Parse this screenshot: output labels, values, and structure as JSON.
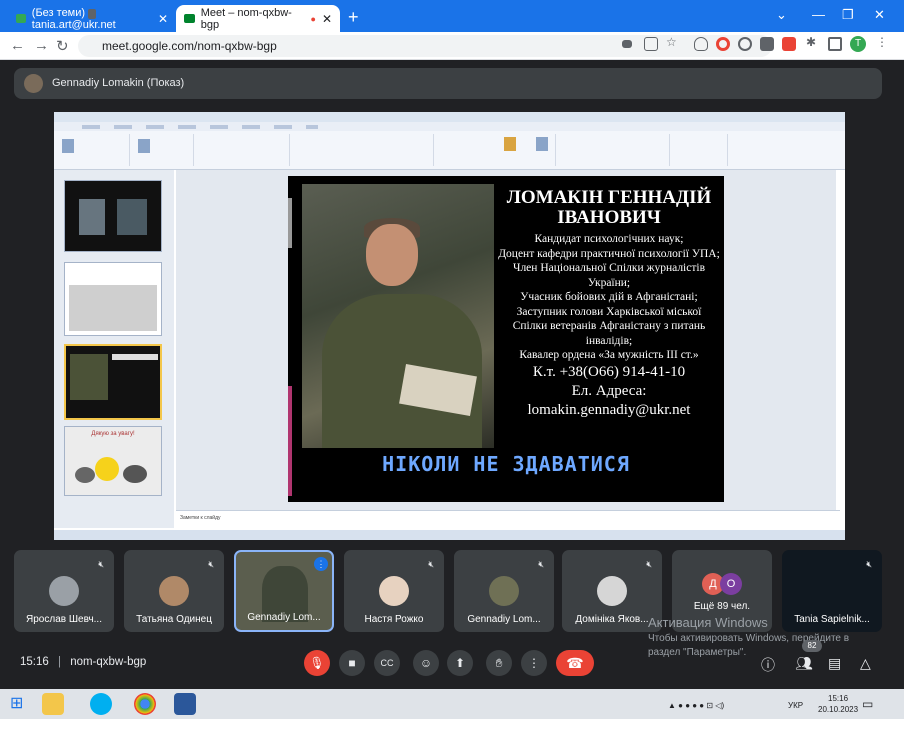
{
  "browser": {
    "tabs": [
      {
        "label": "(Без теми) • tania.art@ukr.net",
        "active": false
      },
      {
        "label": "Meet – nom-qxbw-bgp",
        "active": true
      }
    ],
    "url": "meet.google.com/nom-qxbw-bgp",
    "profile_initial": "T"
  },
  "presenter_bar": {
    "label": "Gennadiy Lomakin (Показ)"
  },
  "slide": {
    "name": "ЛОМАКІН ГЕННАДІЙ ІВАНОВИЧ",
    "lines": [
      "Кандидат психологічних наук;",
      "Доцент кафедри практичної психології УПА;",
      "Член Національної Спілки журналістів України;",
      "Учасник бойових дій в Афганістані;",
      "Заступник голови Харківської міської Спілки ветеранів Афганістану з питань інвалідів;",
      "Кавалер ордена «За мужність ІІІ ст.»"
    ],
    "phone": "К.т. +38(О66) 914-41-10",
    "address_label": "Ел. Адреса:",
    "email": "lomakin.gennadiy@ukr.net",
    "motto": "НІКОЛИ НЕ ЗДАВАТИСЯ"
  },
  "ppt": {
    "notes_placeholder": "Заметки к слайду",
    "thumb_titles": [
      "Дякую за увагу!"
    ]
  },
  "participants": [
    {
      "name": "Ярослав Шевч..."
    },
    {
      "name": "Татьяна Одинец"
    },
    {
      "name": "Gennadiy Lom..."
    },
    {
      "name": "Настя Рожко"
    },
    {
      "name": "Gennadiy Lom..."
    },
    {
      "name": "Домініка Яков..."
    },
    {
      "name": "Ещё 89 чел."
    },
    {
      "name": "Tania Sapielnik..."
    }
  ],
  "more_initials": [
    "Д",
    "О"
  ],
  "watermark": {
    "title": "Активация Windows",
    "text": "Чтобы активировать Windows, перейдите в раздел \"Параметры\"."
  },
  "meeting": {
    "time": "15:16",
    "code": "nom-qxbw-bgp",
    "people_count": "82"
  },
  "taskbar": {
    "lang": "УКР",
    "time": "15:16",
    "date": "20.10.2023"
  },
  "colors": {
    "meet_bg": "#202124",
    "tile_bg": "#3c4043",
    "danger": "#ea4335",
    "accent": "#8ab4f8",
    "chrome_blue": "#1a73e8"
  }
}
